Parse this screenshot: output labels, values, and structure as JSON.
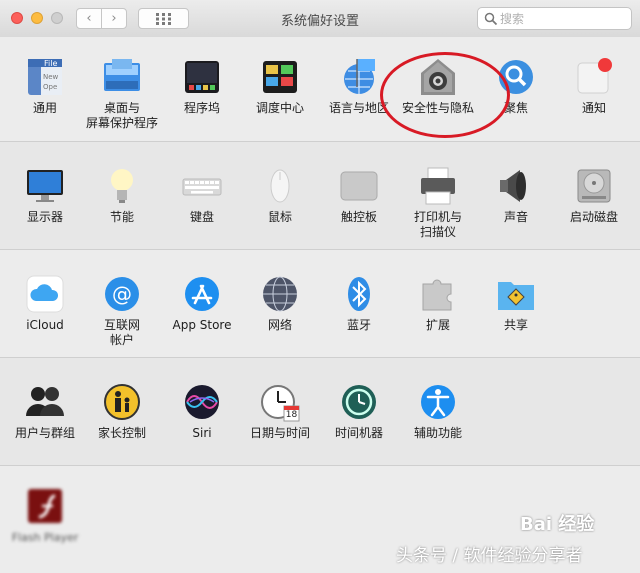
{
  "window": {
    "title": "系统偏好设置",
    "back": "‹",
    "forward": "›",
    "grid": "⋮⋮⋮"
  },
  "search": {
    "placeholder": "搜索",
    "value": ""
  },
  "rows": [
    {
      "items": [
        {
          "label": "通用",
          "icon": "general-icon"
        },
        {
          "label": "桌面与\n屏幕保护程序",
          "icon": "desktop-icon"
        },
        {
          "label": "程序坞",
          "icon": "dock-icon"
        },
        {
          "label": "调度中心",
          "icon": "mission-control-icon"
        },
        {
          "label": "语言与地区",
          "icon": "language-icon"
        },
        {
          "label": "安全性与隐私",
          "icon": "security-icon"
        },
        {
          "label": "聚焦",
          "icon": "spotlight-icon"
        },
        {
          "label": "通知",
          "icon": "notifications-icon"
        }
      ]
    },
    {
      "items": [
        {
          "label": "显示器",
          "icon": "display-icon"
        },
        {
          "label": "节能",
          "icon": "energy-icon"
        },
        {
          "label": "键盘",
          "icon": "keyboard-icon"
        },
        {
          "label": "鼠标",
          "icon": "mouse-icon"
        },
        {
          "label": "触控板",
          "icon": "trackpad-icon"
        },
        {
          "label": "打印机与\n扫描仪",
          "icon": "printer-icon"
        },
        {
          "label": "声音",
          "icon": "sound-icon"
        },
        {
          "label": "启动磁盘",
          "icon": "startup-disk-icon"
        }
      ]
    },
    {
      "items": [
        {
          "label": "iCloud",
          "icon": "icloud-icon"
        },
        {
          "label": "互联网\n帐户",
          "icon": "internet-accounts-icon"
        },
        {
          "label": "App Store",
          "icon": "app-store-icon"
        },
        {
          "label": "网络",
          "icon": "network-icon"
        },
        {
          "label": "蓝牙",
          "icon": "bluetooth-icon"
        },
        {
          "label": "扩展",
          "icon": "extensions-icon"
        },
        {
          "label": "共享",
          "icon": "sharing-icon"
        }
      ]
    },
    {
      "items": [
        {
          "label": "用户与群组",
          "icon": "users-icon"
        },
        {
          "label": "家长控制",
          "icon": "parental-icon"
        },
        {
          "label": "Siri",
          "icon": "siri-icon"
        },
        {
          "label": "日期与时间",
          "icon": "date-time-icon"
        },
        {
          "label": "时间机器",
          "icon": "time-machine-icon"
        },
        {
          "label": "辅助功能",
          "icon": "accessibility-icon"
        }
      ]
    },
    {
      "items": [
        {
          "label": "Flash Player",
          "icon": "flash-icon"
        }
      ]
    }
  ],
  "clock_day": "18",
  "watermark": {
    "baidu": "Bai 经验",
    "source": "头条号 / 软件经验分享者"
  },
  "colors": {
    "close": "#fc605b",
    "minimize": "#fdbc40",
    "zoom": "#c8c8c8",
    "annotation": "#d81a25"
  }
}
